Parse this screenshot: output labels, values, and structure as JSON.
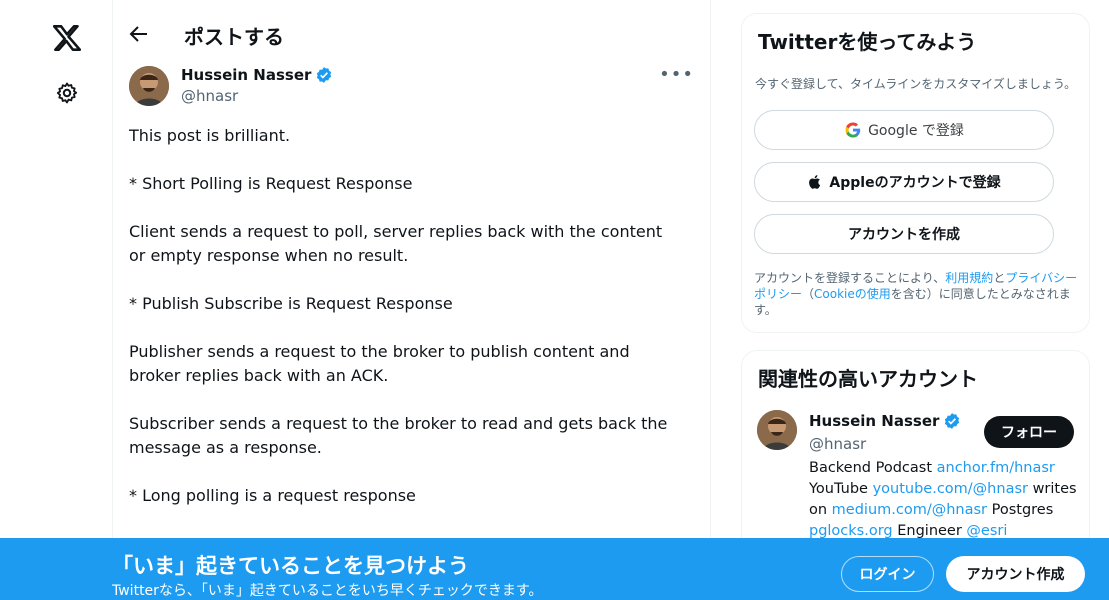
{
  "nav": {
    "logo": "x-logo-icon",
    "settings": "gear-icon"
  },
  "header": {
    "title": "ポストする"
  },
  "post": {
    "author_name": "Hussein Nasser",
    "author_handle": "@hnasr",
    "paragraphs": [
      "This post is brilliant.",
      "* Short Polling is Request Response",
      "Client sends a request to poll, server replies back with the content or empty response when no result.",
      "* Publish Subscribe is Request Response",
      "Publisher sends a request to the broker to publish content and broker replies back with an ACK.",
      "Subscriber sends a request to the broker to read and gets back the message as a response.",
      "* Long polling is a request response"
    ]
  },
  "signup": {
    "title": "Twitterを使ってみよう",
    "subtitle": "今すぐ登録して、タイムラインをカスタマイズしましょう。",
    "google_label": "Google で登録",
    "apple_label": "Appleのアカウントで登録",
    "create_label": "アカウントを作成",
    "legal_prefix": "アカウントを登録することにより、",
    "terms": "利用規約",
    "and": "と",
    "privacy": "プライバシーポリシー",
    "open_paren": "（",
    "cookie": "Cookieの使用",
    "legal_suffix": "を含む）に同意したとみなされます。"
  },
  "related": {
    "title": "関連性の高いアカウント",
    "name": "Hussein Nasser",
    "handle": "@hnasr",
    "follow_label": "フォロー",
    "bio_1": "Backend Podcast ",
    "bio_link_1": "anchor.fm/hnasr",
    "bio_2": "YouTube ",
    "bio_link_2": "youtube.com/@hnasr",
    "bio_3": " writes on ",
    "bio_link_3": "medium.com/@hnasr",
    "bio_4": " Postgres ",
    "bio_link_4": "pglocks.org",
    "bio_5": " Engineer ",
    "bio_link_5": "@esri"
  },
  "banner": {
    "title": "「いま」起きていることを見つけよう",
    "subtitle": "Twitterなら、「いま」起きていることをいち早くチェックできます。",
    "login_label": "ログイン",
    "create_label": "アカウント作成"
  },
  "colors": {
    "accent": "#1d9bf0",
    "text": "#0f1419",
    "muted": "#536471"
  }
}
